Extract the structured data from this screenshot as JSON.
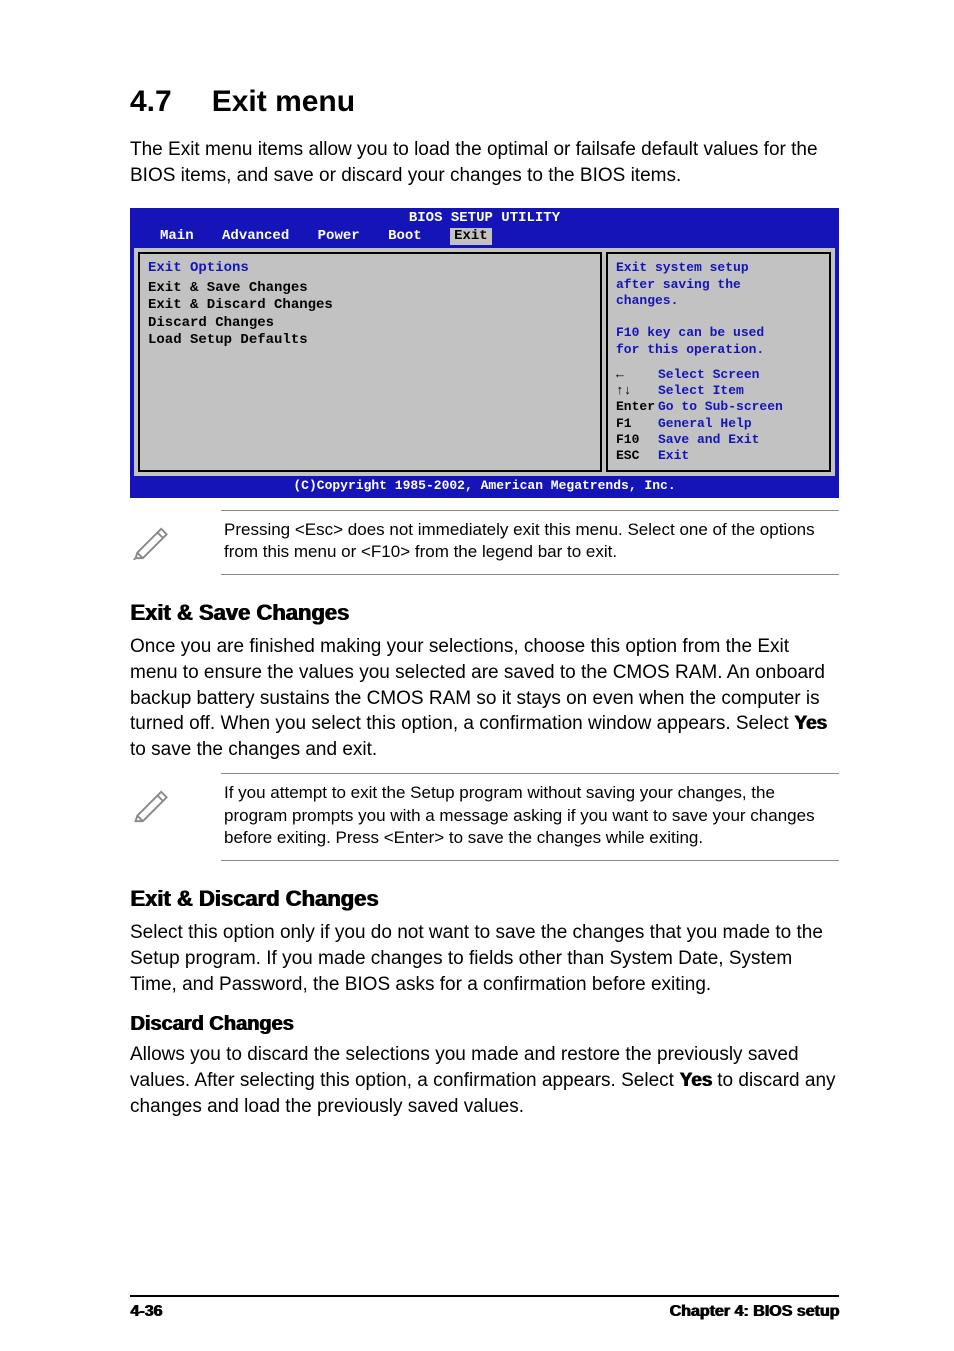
{
  "section": {
    "number": "4.7",
    "title": "Exit menu"
  },
  "intro": "The Exit menu items allow you to load the optimal or failsafe default values for the BIOS items, and save or discard your changes to the BIOS items.",
  "bios": {
    "title": "BIOS SETUP UTILITY",
    "tabs": [
      "Main",
      "Advanced",
      "Power",
      "Boot",
      "Exit"
    ],
    "active_tab": "Exit",
    "left": {
      "header": "Exit Options",
      "items": [
        "Exit & Save Changes",
        "Exit & Discard Changes",
        "Discard Changes",
        "",
        "Load Setup Defaults"
      ]
    },
    "right": {
      "help1": "Exit system setup\nafter saving the\nchanges.\n\nF10 key can be used\nfor this operation.",
      "keys": [
        {
          "key": "←",
          "desc": "Select Screen"
        },
        {
          "key": "↑↓",
          "desc": "Select Item"
        },
        {
          "key": "Enter",
          "desc": "Go to Sub-screen"
        },
        {
          "key": "F1",
          "desc": "General Help"
        },
        {
          "key": "F10",
          "desc": "Save and Exit"
        },
        {
          "key": "ESC",
          "desc": "Exit"
        }
      ]
    },
    "copyright": "(C)Copyright 1985-2002, American Megatrends, Inc."
  },
  "note1": "Pressing <Esc> does not immediately exit this menu. Select one of the options from this menu or <F10> from the legend bar to exit.",
  "sub1": {
    "heading": "Exit & Save Changes",
    "body_pre": "Once you are finished making your selections, choose this option from the Exit menu to ensure the values you selected are saved to the CMOS RAM. An onboard backup battery sustains the CMOS RAM so it stays on even when the computer is turned off. When you select this option, a confirmation window appears. Select ",
    "yes": "Yes",
    "body_post": " to save the changes and exit."
  },
  "note2": " If you attempt to exit the Setup program without saving your changes, the program prompts you with a message asking if you want to save your changes before exiting. Press <Enter>  to save the  changes while exiting.",
  "sub2": {
    "heading": "Exit & Discard Changes",
    "body": "Select this option only if you do not want to save the changes that you made to the Setup program. If you made changes to fields other than System Date, System Time, and Password, the BIOS asks for a confirmation before exiting."
  },
  "sub3": {
    "heading": "Discard Changes",
    "body_pre": "Allows you to discard the selections you made and restore the previously saved values. After selecting this option, a confirmation appears. Select ",
    "yes": "Yes",
    "body_post": " to discard any changes and load the previously saved values."
  },
  "footer": {
    "left": "4-36",
    "right": "Chapter 4: BIOS setup"
  }
}
